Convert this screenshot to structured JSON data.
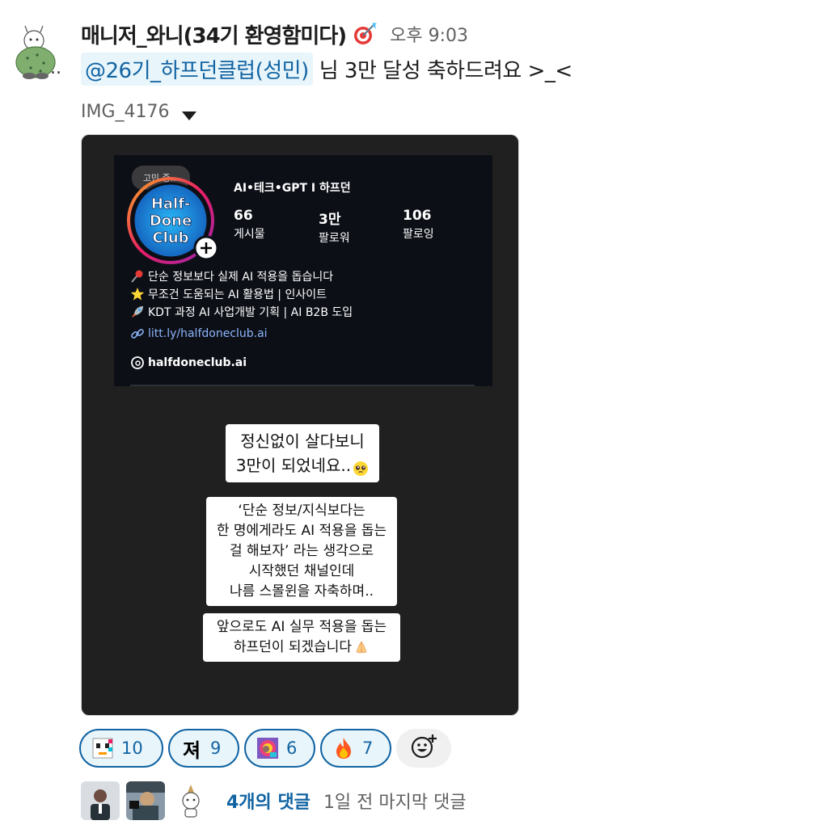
{
  "message": {
    "sender_name": "매니저_와니(34기 환영함미다)",
    "time": "오후 9:03",
    "mention": "@26기_하프던클럽(성민)",
    "text": "님 3만 달성 축하드려요 >_<",
    "status_emoji": "dart-icon",
    "avatar": "cactus-avatar",
    "avatar_suffix": ".."
  },
  "attachment": {
    "file_name": "IMG_4176",
    "profile": {
      "status_pill": "고민 중...",
      "logo_lines": [
        "Half-",
        "Done",
        "Club"
      ],
      "name": "AI•테크•GPT I 하프던",
      "stats": [
        {
          "value": "66",
          "label": "게시물"
        },
        {
          "value": "3만",
          "label": "팔로워"
        },
        {
          "value": "106",
          "label": "팔로잉"
        }
      ],
      "bio": [
        {
          "icon": "pushpin-icon",
          "text": "단순 정보보다 실제 AI 적용을 돕습니다"
        },
        {
          "icon": "star-icon",
          "text": "무조건 도움되는 AI 활용법  |  인사이트"
        },
        {
          "icon": "rocket-icon",
          "text": "KDT 과정 AI 사업개발 기획 | AI B2B 도입"
        }
      ],
      "link": "litt.ly/halfdoneclub.ai",
      "threads_handle": "halfdoneclub.ai"
    },
    "story_texts": {
      "block1": [
        "정신없이 살다보니",
        "3만이 되었네요.."
      ],
      "block2": [
        "‘단순 정보/지식보다는",
        "한 명에게라도 AI 적용을 돕는",
        "걸 해보자’ 라는 생각으로",
        "시작했던 채널인데",
        "나름 스몰윈을 자축하며.."
      ],
      "block3": [
        "앞으로도 AI 실무 적용을 돕는",
        "하프던이 되겠습니다"
      ]
    }
  },
  "reactions": [
    {
      "icon": "pixel-face-icon",
      "count": "10"
    },
    {
      "icon": "char-icon",
      "char": "져",
      "count": "9"
    },
    {
      "icon": "colorful-face-icon",
      "count": "6"
    },
    {
      "icon": "fire-icon",
      "count": "7"
    }
  ],
  "thread": {
    "reply_count": "4개의 댓글",
    "last_reply": "1일 전 마지막 댓글"
  },
  "colors": {
    "link": "#1264a3",
    "mention_bg": "#e8f5fa",
    "image_bg": "#202020"
  }
}
